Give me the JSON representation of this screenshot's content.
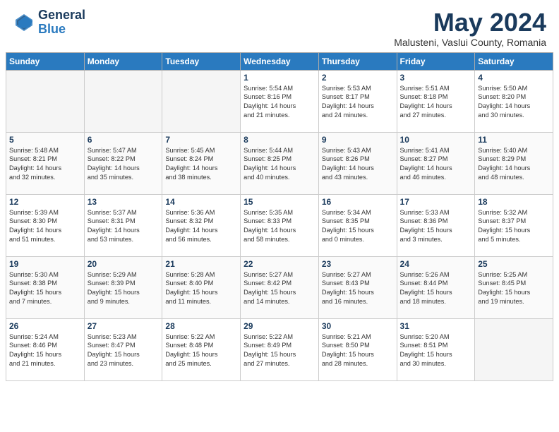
{
  "header": {
    "logo_general": "General",
    "logo_blue": "Blue",
    "month_title": "May 2024",
    "subtitle": "Malusteni, Vaslui County, Romania"
  },
  "days_of_week": [
    "Sunday",
    "Monday",
    "Tuesday",
    "Wednesday",
    "Thursday",
    "Friday",
    "Saturday"
  ],
  "weeks": [
    [
      {
        "day": "",
        "content": ""
      },
      {
        "day": "",
        "content": ""
      },
      {
        "day": "",
        "content": ""
      },
      {
        "day": "1",
        "content": "Sunrise: 5:54 AM\nSunset: 8:16 PM\nDaylight: 14 hours\nand 21 minutes."
      },
      {
        "day": "2",
        "content": "Sunrise: 5:53 AM\nSunset: 8:17 PM\nDaylight: 14 hours\nand 24 minutes."
      },
      {
        "day": "3",
        "content": "Sunrise: 5:51 AM\nSunset: 8:18 PM\nDaylight: 14 hours\nand 27 minutes."
      },
      {
        "day": "4",
        "content": "Sunrise: 5:50 AM\nSunset: 8:20 PM\nDaylight: 14 hours\nand 30 minutes."
      }
    ],
    [
      {
        "day": "5",
        "content": "Sunrise: 5:48 AM\nSunset: 8:21 PM\nDaylight: 14 hours\nand 32 minutes."
      },
      {
        "day": "6",
        "content": "Sunrise: 5:47 AM\nSunset: 8:22 PM\nDaylight: 14 hours\nand 35 minutes."
      },
      {
        "day": "7",
        "content": "Sunrise: 5:45 AM\nSunset: 8:24 PM\nDaylight: 14 hours\nand 38 minutes."
      },
      {
        "day": "8",
        "content": "Sunrise: 5:44 AM\nSunset: 8:25 PM\nDaylight: 14 hours\nand 40 minutes."
      },
      {
        "day": "9",
        "content": "Sunrise: 5:43 AM\nSunset: 8:26 PM\nDaylight: 14 hours\nand 43 minutes."
      },
      {
        "day": "10",
        "content": "Sunrise: 5:41 AM\nSunset: 8:27 PM\nDaylight: 14 hours\nand 46 minutes."
      },
      {
        "day": "11",
        "content": "Sunrise: 5:40 AM\nSunset: 8:29 PM\nDaylight: 14 hours\nand 48 minutes."
      }
    ],
    [
      {
        "day": "12",
        "content": "Sunrise: 5:39 AM\nSunset: 8:30 PM\nDaylight: 14 hours\nand 51 minutes."
      },
      {
        "day": "13",
        "content": "Sunrise: 5:37 AM\nSunset: 8:31 PM\nDaylight: 14 hours\nand 53 minutes."
      },
      {
        "day": "14",
        "content": "Sunrise: 5:36 AM\nSunset: 8:32 PM\nDaylight: 14 hours\nand 56 minutes."
      },
      {
        "day": "15",
        "content": "Sunrise: 5:35 AM\nSunset: 8:33 PM\nDaylight: 14 hours\nand 58 minutes."
      },
      {
        "day": "16",
        "content": "Sunrise: 5:34 AM\nSunset: 8:35 PM\nDaylight: 15 hours\nand 0 minutes."
      },
      {
        "day": "17",
        "content": "Sunrise: 5:33 AM\nSunset: 8:36 PM\nDaylight: 15 hours\nand 3 minutes."
      },
      {
        "day": "18",
        "content": "Sunrise: 5:32 AM\nSunset: 8:37 PM\nDaylight: 15 hours\nand 5 minutes."
      }
    ],
    [
      {
        "day": "19",
        "content": "Sunrise: 5:30 AM\nSunset: 8:38 PM\nDaylight: 15 hours\nand 7 minutes."
      },
      {
        "day": "20",
        "content": "Sunrise: 5:29 AM\nSunset: 8:39 PM\nDaylight: 15 hours\nand 9 minutes."
      },
      {
        "day": "21",
        "content": "Sunrise: 5:28 AM\nSunset: 8:40 PM\nDaylight: 15 hours\nand 11 minutes."
      },
      {
        "day": "22",
        "content": "Sunrise: 5:27 AM\nSunset: 8:42 PM\nDaylight: 15 hours\nand 14 minutes."
      },
      {
        "day": "23",
        "content": "Sunrise: 5:27 AM\nSunset: 8:43 PM\nDaylight: 15 hours\nand 16 minutes."
      },
      {
        "day": "24",
        "content": "Sunrise: 5:26 AM\nSunset: 8:44 PM\nDaylight: 15 hours\nand 18 minutes."
      },
      {
        "day": "25",
        "content": "Sunrise: 5:25 AM\nSunset: 8:45 PM\nDaylight: 15 hours\nand 19 minutes."
      }
    ],
    [
      {
        "day": "26",
        "content": "Sunrise: 5:24 AM\nSunset: 8:46 PM\nDaylight: 15 hours\nand 21 minutes."
      },
      {
        "day": "27",
        "content": "Sunrise: 5:23 AM\nSunset: 8:47 PM\nDaylight: 15 hours\nand 23 minutes."
      },
      {
        "day": "28",
        "content": "Sunrise: 5:22 AM\nSunset: 8:48 PM\nDaylight: 15 hours\nand 25 minutes."
      },
      {
        "day": "29",
        "content": "Sunrise: 5:22 AM\nSunset: 8:49 PM\nDaylight: 15 hours\nand 27 minutes."
      },
      {
        "day": "30",
        "content": "Sunrise: 5:21 AM\nSunset: 8:50 PM\nDaylight: 15 hours\nand 28 minutes."
      },
      {
        "day": "31",
        "content": "Sunrise: 5:20 AM\nSunset: 8:51 PM\nDaylight: 15 hours\nand 30 minutes."
      },
      {
        "day": "",
        "content": ""
      }
    ]
  ]
}
